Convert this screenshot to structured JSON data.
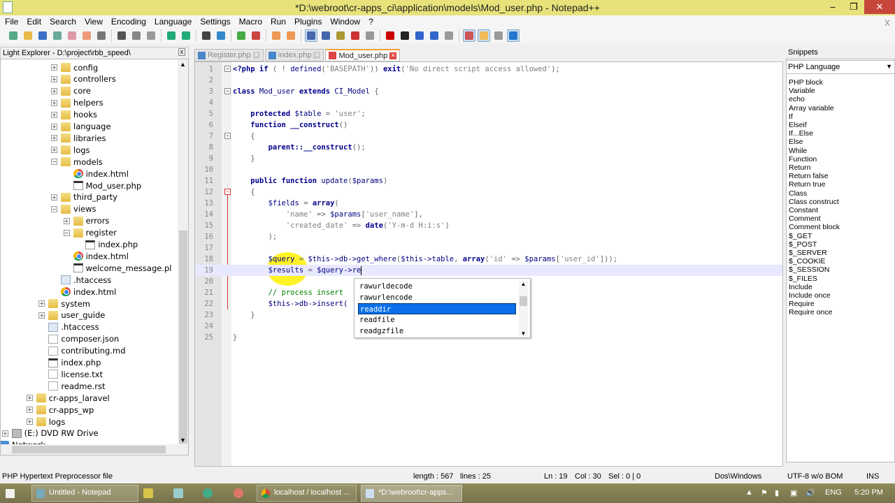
{
  "window": {
    "title": "*D:\\webroot\\cr-apps_ci\\application\\models\\Mod_user.php - Notepad++",
    "minimize": "–",
    "maximize": "❐",
    "close": "✕"
  },
  "menu": {
    "items": [
      "File",
      "Edit",
      "Search",
      "View",
      "Encoding",
      "Language",
      "Settings",
      "Macro",
      "Run",
      "Plugins",
      "Window",
      "?"
    ],
    "close_x": "X"
  },
  "toolbar": {
    "icons": [
      "new-file",
      "open-file",
      "save",
      "save-all",
      "close",
      "close-all",
      "print",
      "|",
      "cut",
      "copy",
      "paste",
      "|",
      "undo",
      "redo",
      "|",
      "find",
      "replace",
      "|",
      "zoom-in",
      "zoom-out",
      "|",
      "sync-v",
      "sync-h",
      "|",
      "word-wrap",
      "show-all-chars",
      "indent-guide",
      "user-lang",
      "doc-map",
      "|",
      "record-macro",
      "stop-record",
      "play-macro",
      "run-macro-multiple",
      "save-macro",
      "|",
      "spell-check",
      "light-explorer",
      "snippets",
      "s-plugin"
    ]
  },
  "explorer": {
    "title": "Light Explorer - D:\\project\\rbb_speed\\",
    "close": "x",
    "items": [
      {
        "label": "config",
        "type": "folder",
        "level": 5,
        "toggle": "+"
      },
      {
        "label": "controllers",
        "type": "folder",
        "level": 5,
        "toggle": "+"
      },
      {
        "label": "core",
        "type": "folder",
        "level": 5,
        "toggle": "+"
      },
      {
        "label": "helpers",
        "type": "folder",
        "level": 5,
        "toggle": "+"
      },
      {
        "label": "hooks",
        "type": "folder",
        "level": 5,
        "toggle": "+"
      },
      {
        "label": "language",
        "type": "folder",
        "level": 5,
        "toggle": "+"
      },
      {
        "label": "libraries",
        "type": "folder",
        "level": 5,
        "toggle": "+"
      },
      {
        "label": "logs",
        "type": "folder",
        "level": 5,
        "toggle": "+"
      },
      {
        "label": "models",
        "type": "folder",
        "level": 5,
        "toggle": "-"
      },
      {
        "label": "index.html",
        "type": "chrome",
        "level": 6,
        "toggle": ""
      },
      {
        "label": "Mod_user.php",
        "type": "php",
        "level": 6,
        "toggle": ""
      },
      {
        "label": "third_party",
        "type": "folder",
        "level": 5,
        "toggle": "+"
      },
      {
        "label": "views",
        "type": "folder",
        "level": 5,
        "toggle": "-"
      },
      {
        "label": "errors",
        "type": "folder",
        "level": 6,
        "toggle": "+"
      },
      {
        "label": "register",
        "type": "folder",
        "level": 6,
        "toggle": "-"
      },
      {
        "label": "index.php",
        "type": "php",
        "level": 7,
        "toggle": ""
      },
      {
        "label": "index.html",
        "type": "chrome",
        "level": 6,
        "toggle": ""
      },
      {
        "label": "welcome_message.pl",
        "type": "php",
        "level": 6,
        "toggle": ""
      },
      {
        "label": ".htaccess",
        "type": "ht",
        "level": 5,
        "toggle": ""
      },
      {
        "label": "index.html",
        "type": "chrome",
        "level": 5,
        "toggle": ""
      },
      {
        "label": "system",
        "type": "folder",
        "level": 4,
        "toggle": "+"
      },
      {
        "label": "user_guide",
        "type": "folder",
        "level": 4,
        "toggle": "+"
      },
      {
        "label": ".htaccess",
        "type": "ht",
        "level": 4,
        "toggle": ""
      },
      {
        "label": "composer.json",
        "type": "txt",
        "level": 4,
        "toggle": ""
      },
      {
        "label": "contributing.md",
        "type": "txt",
        "level": 4,
        "toggle": ""
      },
      {
        "label": "index.php",
        "type": "php",
        "level": 4,
        "toggle": ""
      },
      {
        "label": "license.txt",
        "type": "txt",
        "level": 4,
        "toggle": ""
      },
      {
        "label": "readme.rst",
        "type": "txt",
        "level": 4,
        "toggle": ""
      },
      {
        "label": "cr-apps_laravel",
        "type": "folder",
        "level": 3,
        "toggle": "+"
      },
      {
        "label": "cr-apps_wp",
        "type": "folder",
        "level": 3,
        "toggle": "+"
      },
      {
        "label": "logs",
        "type": "folder",
        "level": 3,
        "toggle": "+"
      },
      {
        "label": "(E:) DVD RW Drive",
        "type": "drive",
        "level": 1,
        "toggle": "+"
      },
      {
        "label": "Network",
        "type": "net",
        "level": 0,
        "toggle": "+"
      }
    ]
  },
  "tabs": [
    {
      "label": "Register.php",
      "active": false
    },
    {
      "label": "index.php",
      "active": false
    },
    {
      "label": "Mod_user.php",
      "active": true
    }
  ],
  "editor": {
    "current_line": 19,
    "lines": [
      [
        [
          "kw",
          "<?php"
        ],
        [
          "kw",
          " if"
        ],
        [
          "op",
          " ( ! "
        ],
        [
          "var",
          "defined"
        ],
        [
          "op",
          "("
        ],
        [
          "str",
          "'BASEPATH'"
        ],
        [
          "op",
          ")) "
        ],
        [
          "kw",
          "exit"
        ],
        [
          "op",
          "("
        ],
        [
          "str",
          "'No direct script access allowed'"
        ],
        [
          "op",
          ");"
        ]
      ],
      [],
      [
        [
          "kw",
          "class"
        ],
        [
          "var",
          " Mod_user "
        ],
        [
          "kw",
          "extends"
        ],
        [
          "var",
          " CI_Model "
        ],
        [
          "op",
          "{"
        ]
      ],
      [],
      [
        [
          "kw",
          "    protected"
        ],
        [
          "var",
          " $table "
        ],
        [
          "op",
          "= "
        ],
        [
          "str",
          "'user'"
        ],
        [
          "op",
          ";"
        ]
      ],
      [
        [
          "kw",
          "    function"
        ],
        [
          "kw",
          " __construct"
        ],
        [
          "op",
          "()"
        ]
      ],
      [
        [
          "op",
          "    {"
        ]
      ],
      [
        [
          "kw",
          "        parent::__construct"
        ],
        [
          "op",
          "();"
        ]
      ],
      [
        [
          "op",
          "    }"
        ]
      ],
      [],
      [
        [
          "kw",
          "    public function"
        ],
        [
          "var",
          " update"
        ],
        [
          "op",
          "("
        ],
        [
          "var",
          "$params"
        ],
        [
          "op",
          ")"
        ]
      ],
      [
        [
          "op",
          "    {"
        ]
      ],
      [
        [
          "var",
          "        $fields "
        ],
        [
          "op",
          "= "
        ],
        [
          "kw",
          "array"
        ],
        [
          "op",
          "("
        ]
      ],
      [
        [
          "str",
          "            'name'"
        ],
        [
          "op",
          " => "
        ],
        [
          "var",
          "$params"
        ],
        [
          "op",
          "["
        ],
        [
          "str",
          "'user_name'"
        ],
        [
          "op",
          "],"
        ]
      ],
      [
        [
          "str",
          "            'created_date'"
        ],
        [
          "op",
          " => "
        ],
        [
          "kw",
          "date"
        ],
        [
          "op",
          "("
        ],
        [
          "str",
          "'Y-m-d H:i:s'"
        ],
        [
          "op",
          ")"
        ]
      ],
      [
        [
          "op",
          "        );"
        ]
      ],
      [],
      [
        [
          "var",
          "        $query "
        ],
        [
          "op",
          "= "
        ],
        [
          "var",
          "$this->db->get_where"
        ],
        [
          "op",
          "("
        ],
        [
          "var",
          "$this->table"
        ],
        [
          "op",
          ", "
        ],
        [
          "kw",
          "array"
        ],
        [
          "op",
          "("
        ],
        [
          "str",
          "'id'"
        ],
        [
          "op",
          " => "
        ],
        [
          "var",
          "$params"
        ],
        [
          "op",
          "["
        ],
        [
          "str",
          "'user_id'"
        ],
        [
          "op",
          "]));"
        ]
      ],
      [
        [
          "var",
          "        $results "
        ],
        [
          "op",
          "= "
        ],
        [
          "var",
          "$query->re"
        ]
      ],
      [],
      [
        [
          "cmt",
          "        // process insert"
        ]
      ],
      [
        [
          "var",
          "        $this->db->insert("
        ]
      ],
      [
        [
          "op",
          "    }"
        ]
      ],
      [],
      [
        [
          "op",
          "}"
        ]
      ]
    ]
  },
  "autocomplete": {
    "items": [
      "rawurldecode",
      "rawurlencode",
      "readdir",
      "readfile",
      "readgzfile"
    ],
    "selected": "readdir"
  },
  "snippets": {
    "title": "Snippets",
    "language": "PHP Language",
    "items": [
      "PHP block",
      "Variable",
      "echo",
      "Array variable",
      "If",
      "Elseif",
      "If...Else",
      "Else",
      "While",
      "Function",
      "Return",
      "Return false",
      "Return true",
      "Class",
      "Class construct",
      "Constant",
      "Comment",
      "Comment block",
      "$_GET",
      "$_POST",
      "$_SERVER",
      "$_COOKIE",
      "$_SESSION",
      "$_FILES",
      "Include",
      "Include once",
      "Require",
      "Require once"
    ]
  },
  "status": {
    "file_type": "PHP Hypertext Preprocessor file",
    "length": "length : 567",
    "lines": "lines : 25",
    "ln": "Ln : 19",
    "col": "Col : 30",
    "sel": "Sel : 0 | 0",
    "eol": "Dos\\Windows",
    "encoding": "UTF-8 w/o BOM",
    "mode": "INS"
  },
  "taskbar": {
    "tasks": [
      "Untitled - Notepad",
      "localhost / localhost ...",
      "*D:\\webroot\\cr-apps..."
    ],
    "lang": "ENG",
    "time": "5:20 PM"
  }
}
